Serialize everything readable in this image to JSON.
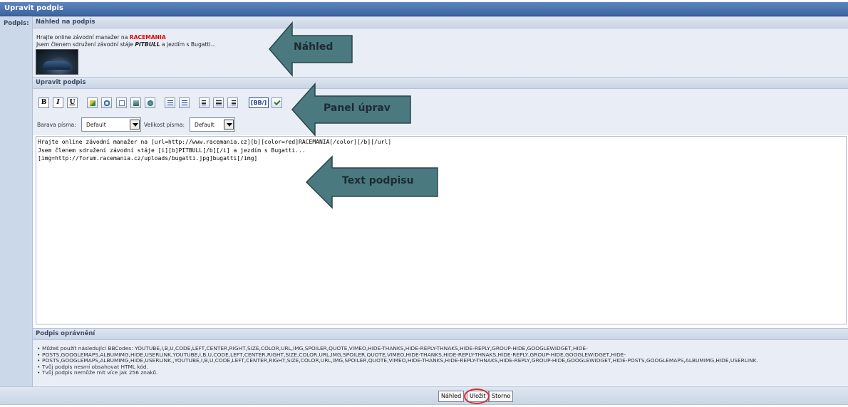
{
  "title": "Upravit podpis",
  "left_label": "Podpis:",
  "preview": {
    "heading": "Náhled na podpis",
    "line1_prefix": "Hrajte online závodní manažer na ",
    "line1_link": "RACEMANIA",
    "line2_prefix": "Jsem členem sdružení závodní stáje ",
    "line2_bold": "PITBULL",
    "line2_suffix": " a jezdím s Bugatti...",
    "image_alt": "bugatti"
  },
  "editor": {
    "heading": "Upravit podpis",
    "buttons": [
      "B",
      "I",
      "U"
    ],
    "bbcode_label": "[BB/]",
    "font_color_label": "Barava písma:",
    "font_color_value": "Default",
    "font_size_label": "Velikost písma:",
    "font_size_value": "Default",
    "text": "Hrajte online závodní manažer na [url=http://www.racemania.cz][b][color=red]RACEMANIA[/color][/b][/url]\nJsem členem sdružení závodní stáje [i][b]PITBULL[/b][/i] a jezdím s Bugatti...\n[img=http://forum.racemania.cz/uploads/bugatti.jpg]bugatti[/img]"
  },
  "permissions": {
    "heading": "Podpis oprávnění",
    "items": [
      "Můžeš použít následující BBCodes: YOUTUBE,I,B,U,CODE,LEFT,CENTER,RIGHT,SIZE,COLOR,URL,IMG,SPOILER,QUOTE,VIMEO,HIDE-THANKS,HIDE-REPLY-THNAKS,HIDE-REPLY,GROUP-HIDE,GOOGLEWIDGET,HIDE-",
      "POSTS,GOOGLEMAPS,ALBUMIMG,HIDE,USERLINK,YOUTUBE,I,B,U,CODE,LEFT,CENTER,RIGHT,SIZE,COLOR,URL,IMG,SPOILER,QUOTE,VIMEO,HIDE-THANKS,HIDE-REPLY-THNAKS,HIDE-REPLY,GROUP-HIDE,GOOGLEWIDGET,HIDE-",
      "POSTS,GOOGLEMAPS,ALBUMIMG,HIDE,USERLINK,,YOUTUBE,I,B,U,CODE,LEFT,CENTER,RIGHT,SIZE,COLOR,URL,IMG,SPOILER,QUOTE,VIMEO,HIDE-THANKS,HIDE-REPLY-THNAKS,HIDE-REPLY,GROUP-HIDE,GOOGLEWIDGET,HIDE-POSTS,GOOGLEMAPS,ALBUMIMG,HIDE,USERLINK.",
      "Tvůj podpis nesmí obsahovat HTML kód.",
      "Tvůj podpis nemůže mít více jak 256 znaků."
    ]
  },
  "footer": {
    "preview_label": "Náhled",
    "save_label": "Uložit",
    "cancel_label": "Storno"
  },
  "annotations": {
    "preview": "Náhled",
    "toolbar": "Panel úprav",
    "text": "Text podpisu"
  },
  "colors": {
    "header_blue": "#3c659f",
    "link_red": "#dd0000",
    "annotation_arrow": "#4a7a7f",
    "highlight_ring": "#d43030"
  }
}
